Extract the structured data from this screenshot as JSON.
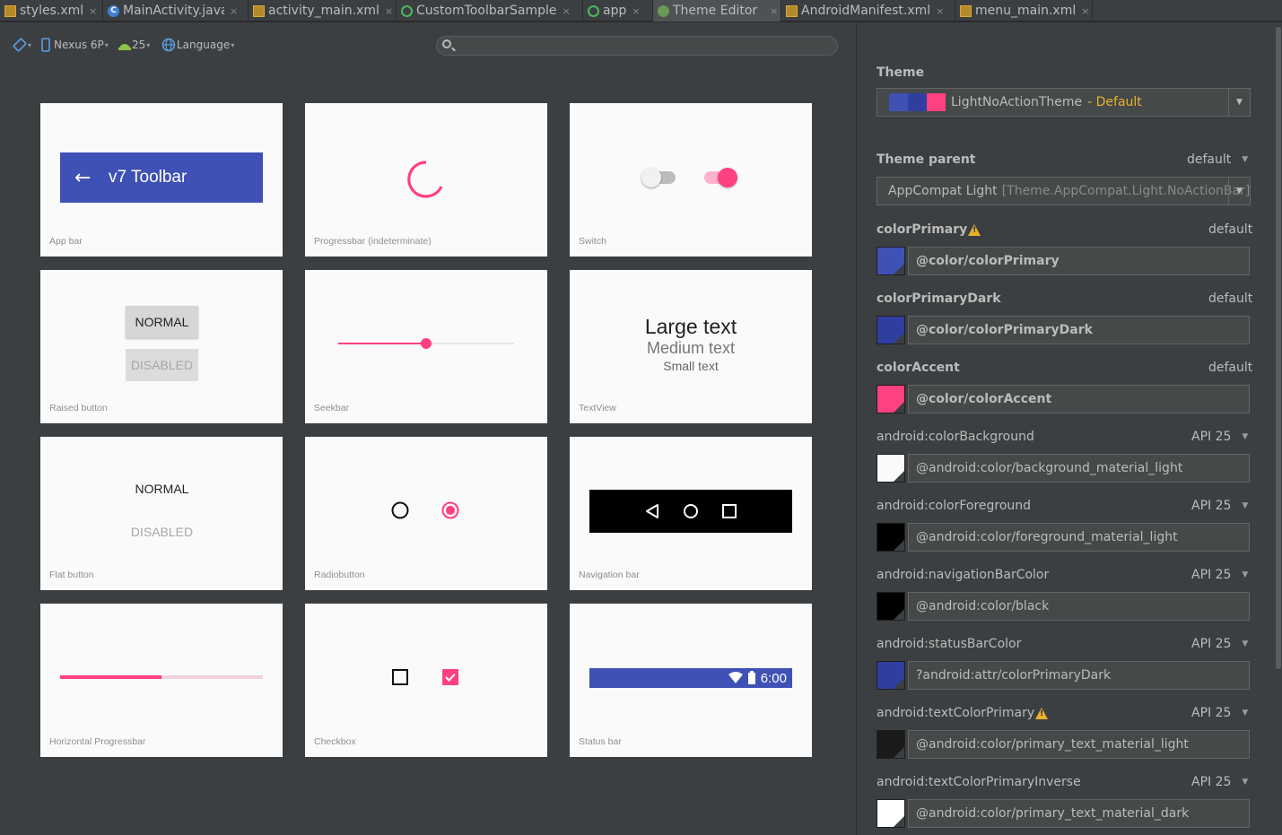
{
  "tabs": [
    {
      "label": "styles.xml",
      "icon": "xml-file-icon",
      "active": false
    },
    {
      "label": "MainActivity.java",
      "icon": "java-class-icon",
      "active": false
    },
    {
      "label": "activity_main.xml",
      "icon": "xml-file-icon",
      "active": false
    },
    {
      "label": "CustomToolbarSample",
      "icon": "run-config-icon",
      "active": false
    },
    {
      "label": "app",
      "icon": "run-config-icon",
      "active": false
    },
    {
      "label": "Theme Editor",
      "icon": "theme-editor-icon",
      "active": true
    },
    {
      "label": "AndroidManifest.xml",
      "icon": "xml-file-icon",
      "active": false
    },
    {
      "label": "menu_main.xml",
      "icon": "xml-file-icon",
      "active": false
    }
  ],
  "toolbar": {
    "device": "Nexus 6P",
    "api": "25",
    "language": "Language"
  },
  "preview": {
    "app_bar": {
      "title": "v7 Toolbar",
      "caption": "App bar"
    },
    "progressbar": {
      "caption": "Progressbar (indeterminate)"
    },
    "switch": {
      "caption": "Switch"
    },
    "raised_button": {
      "normal": "NORMAL",
      "disabled": "DISABLED",
      "caption": "Raised button"
    },
    "seekbar": {
      "caption": "Seekbar",
      "value_fraction": 0.5
    },
    "textview": {
      "large": "Large text",
      "medium": "Medium text",
      "small": "Small text",
      "caption": "TextView"
    },
    "flat_button": {
      "normal": "NORMAL",
      "disabled": "DISABLED",
      "caption": "Flat button"
    },
    "radiobutton": {
      "caption": "Radiobutton"
    },
    "navigation_bar": {
      "caption": "Navigation bar"
    },
    "horizontal_progress": {
      "caption": "Horizontal Progressbar",
      "value_fraction": 0.5
    },
    "checkbox": {
      "caption": "Checkbox"
    },
    "status_bar": {
      "time": "6:00",
      "caption": "Status bar"
    }
  },
  "panel": {
    "theme_heading": "Theme",
    "theme_name": "LightNoActionTheme",
    "theme_suffix": "- Default",
    "theme_parent_label": "Theme parent",
    "theme_parent_scope": "default",
    "theme_parent_name": "AppCompat Light",
    "theme_parent_detail": "[Theme.AppCompat.Light.NoActionBar]",
    "attributes": [
      {
        "name": "colorPrimary",
        "scope": "default",
        "value": "@color/colorPrimary",
        "bold": true,
        "warning": true,
        "color": "#3f51b5"
      },
      {
        "name": "colorPrimaryDark",
        "scope": "default",
        "value": "@color/colorPrimaryDark",
        "bold": true,
        "warning": false,
        "color": "#303f9f"
      },
      {
        "name": "colorAccent",
        "scope": "default",
        "value": "@color/colorAccent",
        "bold": true,
        "warning": false,
        "color": "#ff4081"
      },
      {
        "name": "android:colorBackground",
        "scope": "API 25",
        "value": "@android:color/background_material_light",
        "bold": false,
        "warning": false,
        "color": "#fafafa"
      },
      {
        "name": "android:colorForeground",
        "scope": "API 25",
        "value": "@android:color/foreground_material_light",
        "bold": false,
        "warning": false,
        "color": "#000000"
      },
      {
        "name": "android:navigationBarColor",
        "scope": "API 25",
        "value": "@android:color/black",
        "bold": false,
        "warning": false,
        "color": "#000000"
      },
      {
        "name": "android:statusBarColor",
        "scope": "API 25",
        "value": "?android:attr/colorPrimaryDark",
        "bold": false,
        "warning": false,
        "color": "#303f9f"
      },
      {
        "name": "android:textColorPrimary",
        "scope": "API 25",
        "value": "@android:color/primary_text_material_light",
        "bold": false,
        "warning": true,
        "color": "#1a1a1a"
      },
      {
        "name": "android:textColorPrimaryInverse",
        "scope": "API 25",
        "value": "@android:color/primary_text_material_dark",
        "bold": false,
        "warning": false,
        "color": "#ffffff"
      }
    ]
  },
  "colors": {
    "primary": "#3f51b5",
    "primary_dark": "#303f9f",
    "accent": "#ff4081"
  }
}
